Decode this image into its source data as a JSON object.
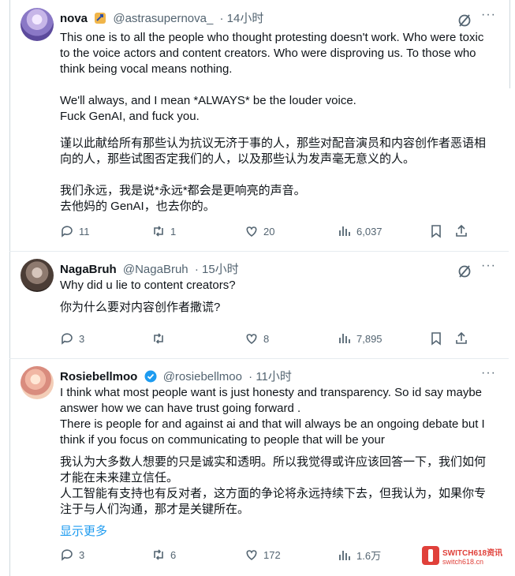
{
  "posts": [
    {
      "name": "nova",
      "handle": "@astrasupernova_",
      "time": "· 14小时",
      "en_lines": "This one is to all the people who thought protesting doesn't work. Who were toxic to the voice actors and content creators. Who were disproving us. To those who think being vocal means nothing.\n\nWe'll always, and I mean *ALWAYS* be the louder voice.\nFuck GenAI, and fuck you.",
      "zh_lines": "谨以此献给所有那些认为抗议无济于事的人，那些对配音演员和内容创作者恶语相向的人，那些试图否定我们的人，以及那些认为发声毫无意义的人。\n\n我们永远，我是说*永远*都会是更响亮的声音。\n去他妈的 GenAI，也去你的。",
      "replies": "11",
      "reposts": "1",
      "likes": "20",
      "views": "6,037"
    },
    {
      "name": "NagaBruh",
      "handle": "@NagaBruh",
      "time": "· 15小时",
      "en_lines": "Why did u lie to content creators?",
      "zh_lines": "你为什么要对内容创作者撒谎?",
      "replies": "3",
      "reposts": "",
      "likes": "8",
      "views": "7,895"
    },
    {
      "name": "Rosiebellmoo",
      "handle": "@rosiebellmoo",
      "time": "· 11小时",
      "en_lines": "I think what most people want is just honesty and transparency. So id say maybe answer how we can have trust going forward .\nThere is people for and against ai and that will always be an ongoing debate but I think if you focus on communicating to people that will be your",
      "zh_lines": "我认为大多数人想要的只是诚实和透明。所以我觉得或许应该回答一下，我们如何才能在未来建立信任。\n人工智能有支持也有反对者，这方面的争论将永远持续下去，但我认为，如果你专注于与人们沟通，那才是关键所在。",
      "show_more": "显示更多",
      "replies": "3",
      "reposts": "6",
      "likes": "172",
      "views": "1.6万"
    }
  ],
  "more_glyph": "···",
  "watermark": {
    "line1": "SWITCH618资讯",
    "line2": "switch618.cn"
  },
  "colors": {
    "accent": "#1d9bf0",
    "muted": "#536471",
    "verified": "#1d9bf0",
    "watermark": "#e0403a"
  }
}
